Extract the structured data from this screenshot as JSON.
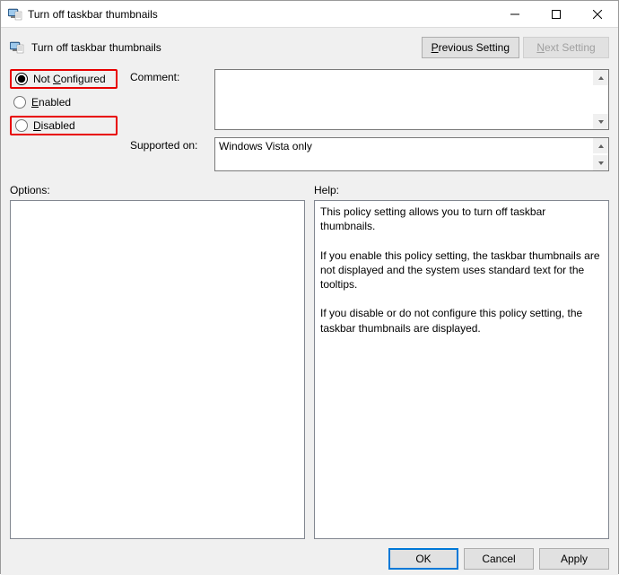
{
  "window": {
    "title": "Turn off taskbar thumbnails"
  },
  "header": {
    "policy_title": "Turn off taskbar thumbnails",
    "previous_setting": "Previous Setting",
    "next_setting": "Next Setting"
  },
  "radios": {
    "not_configured": "Not Configured",
    "enabled": "Enabled",
    "disabled": "Disabled",
    "selected": "not_configured"
  },
  "fields": {
    "comment_label": "Comment:",
    "comment_value": "",
    "supported_label": "Supported on:",
    "supported_value": "Windows Vista only"
  },
  "panes": {
    "options_label": "Options:",
    "help_label": "Help:",
    "help_text": "This policy setting allows you to turn off taskbar thumbnails.\n\nIf you enable this policy setting, the taskbar thumbnails are not displayed and the system uses standard text for the tooltips.\n\nIf you disable or do not configure this policy setting, the taskbar thumbnails are displayed."
  },
  "buttons": {
    "ok": "OK",
    "cancel": "Cancel",
    "apply": "Apply"
  }
}
